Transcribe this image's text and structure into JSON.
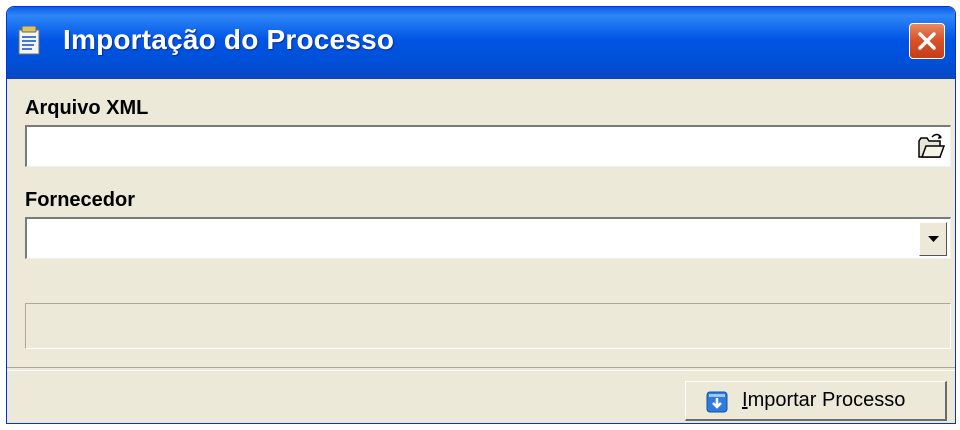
{
  "window": {
    "title": "Importação do Processo"
  },
  "form": {
    "xml_file": {
      "label": "Arquivo XML",
      "value": "",
      "browse_icon": "open-folder-icon"
    },
    "supplier": {
      "label": "Fornecedor",
      "value": "",
      "dropdown_icon": "chevron-down-icon"
    },
    "status_text": ""
  },
  "footer": {
    "import_button": {
      "mnemonic": "I",
      "label_rest": "mportar Processo",
      "icon": "import-arrow-icon"
    }
  },
  "colors": {
    "titlebar": "#0055e5",
    "window_bg": "#ece9d8",
    "close_button": "#d9542a"
  }
}
